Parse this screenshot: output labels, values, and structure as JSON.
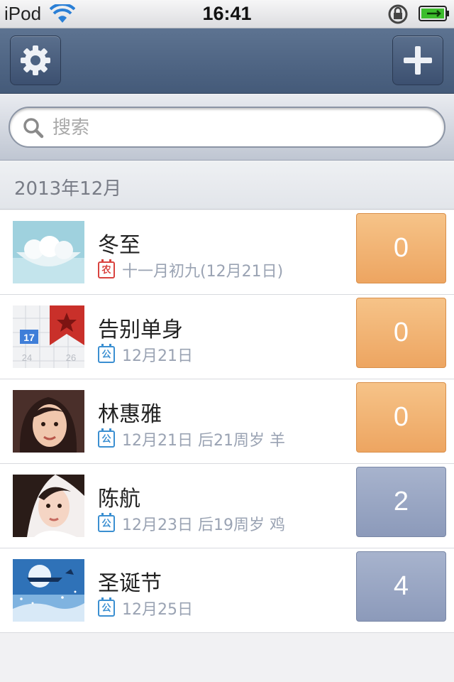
{
  "status_bar": {
    "carrier": "iPod",
    "time": "16:41"
  },
  "nav": {
    "settings_icon": "gear-icon",
    "add_icon": "plus-icon"
  },
  "search": {
    "placeholder": "搜索"
  },
  "section": {
    "title": "2013年12月"
  },
  "items": [
    {
      "title": "冬至",
      "calendar": "农",
      "date_text": "十一月初九(12月21日)",
      "count": "0",
      "count_color": "#eda561",
      "thumb": "dumplings"
    },
    {
      "title": "告别单身",
      "calendar": "公",
      "date_text": "12月21日",
      "count": "0",
      "count_color": "#eda561",
      "thumb": "calendar-bookmark"
    },
    {
      "title": "林惠雅",
      "calendar": "公",
      "date_text": "12月21日  后21周岁  羊",
      "count": "0",
      "count_color": "#eda561",
      "thumb": "portrait"
    },
    {
      "title": "陈航",
      "calendar": "公",
      "date_text": "12月23日  后19周岁  鸡",
      "count": "2",
      "count_color": "#8c9aba",
      "thumb": "portrait"
    },
    {
      "title": "圣诞节",
      "calendar": "公",
      "date_text": "12月25日",
      "count": "4",
      "count_color": "#8c9aba",
      "thumb": "christmas-night"
    }
  ]
}
